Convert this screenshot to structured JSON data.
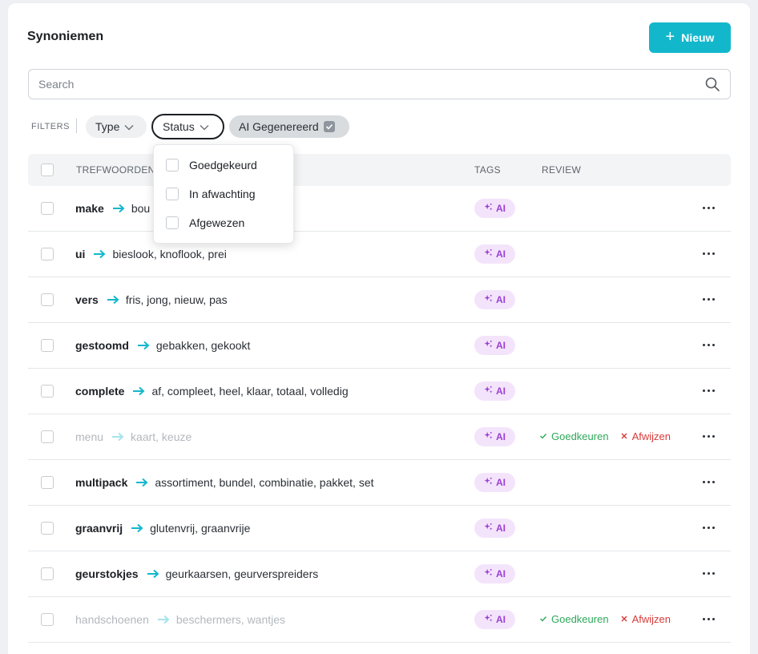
{
  "header": {
    "title": "Synoniemen",
    "new_button": "Nieuw"
  },
  "search": {
    "placeholder": "Search"
  },
  "filters": {
    "label": "FILTERS",
    "type": "Type",
    "status": "Status",
    "ai": "AI Gegenereerd"
  },
  "status_dropdown": {
    "options": [
      "Goedgekeurd",
      "In afwachting",
      "Afgewezen"
    ]
  },
  "table": {
    "headers": {
      "keywords": "TREFWOORDEN",
      "tags": "TAGS",
      "review": "REVIEW"
    },
    "tag_label": "AI",
    "approve_label": "Goedkeuren",
    "reject_label": "Afwijzen",
    "rows": [
      {
        "term": "make",
        "synonyms": "bou",
        "pending": false
      },
      {
        "term": "ui",
        "synonyms": "bieslook, knoflook, prei",
        "pending": false
      },
      {
        "term": "vers",
        "synonyms": "fris, jong, nieuw, pas",
        "pending": false
      },
      {
        "term": "gestoomd",
        "synonyms": "gebakken, gekookt",
        "pending": false
      },
      {
        "term": "complete",
        "synonyms": "af, compleet, heel, klaar, totaal, volledig",
        "pending": false
      },
      {
        "term": "menu",
        "synonyms": "kaart, keuze",
        "pending": true
      },
      {
        "term": "multipack",
        "synonyms": "assortiment, bundel, combinatie, pakket, set",
        "pending": false
      },
      {
        "term": "graanvrij",
        "synonyms": "glutenvrij, graanvrije",
        "pending": false
      },
      {
        "term": "geurstokjes",
        "synonyms": "geurkaarsen, geurverspreiders",
        "pending": false
      },
      {
        "term": "handschoenen",
        "synonyms": "beschermers, wantjes",
        "pending": true
      }
    ]
  },
  "colors": {
    "accent": "#13b7cc",
    "ai_tag_bg": "#f3e4fb",
    "ai_tag_fg": "#9b3fd4",
    "approve": "#2fa85a",
    "reject": "#d93a3a"
  }
}
